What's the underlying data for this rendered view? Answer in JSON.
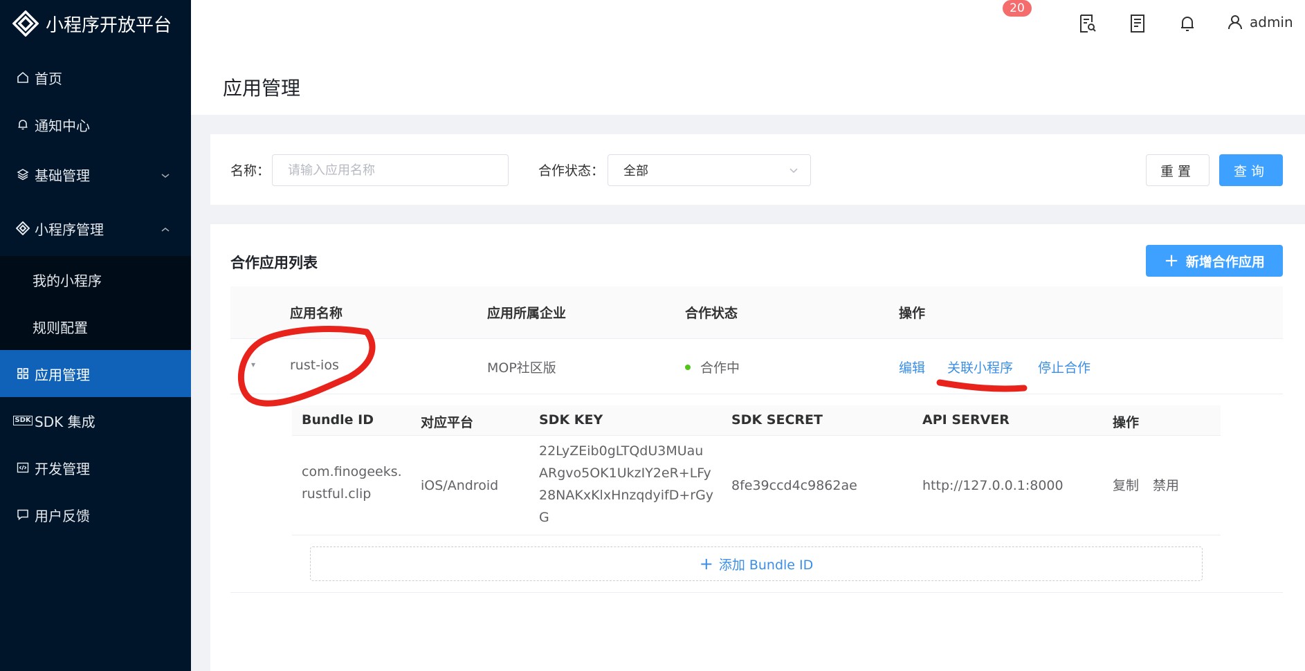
{
  "sidebar": {
    "logo_text": "小程序开放平台",
    "items": [
      {
        "label": "首页",
        "icon": "home-icon"
      },
      {
        "label": "通知中心",
        "icon": "bell-icon"
      },
      {
        "label": "基础管理",
        "icon": "layers-icon"
      },
      {
        "label": "小程序管理",
        "icon": "diamond-logo-icon"
      },
      {
        "label": "我的小程序"
      },
      {
        "label": "规则配置"
      },
      {
        "label": "应用管理",
        "icon": "grid-icon"
      },
      {
        "label": "SDK 集成",
        "icon": "sdk-icon",
        "icon_text": "SDK"
      },
      {
        "label": "开发管理",
        "icon": "code-icon"
      },
      {
        "label": "用户反馈",
        "icon": "message-icon"
      }
    ]
  },
  "header": {
    "notification_count": "20",
    "username": "admin"
  },
  "page": {
    "title": "应用管理"
  },
  "filter": {
    "name_label": "名称：",
    "name_placeholder": "请输入应用名称",
    "status_label": "合作状态：",
    "status_value": "全部",
    "reset_label": "重置",
    "query_label": "查询"
  },
  "list": {
    "title": "合作应用列表",
    "add_button": "新增合作应用",
    "columns": [
      "应用名称",
      "应用所属企业",
      "合作状态",
      "操作"
    ],
    "rows": [
      {
        "name": "rust-ios",
        "company": "MOP社区版",
        "status": "合作中",
        "actions": [
          "编辑",
          "关联小程序",
          "停止合作"
        ]
      }
    ]
  },
  "bundle_table": {
    "columns": [
      "Bundle ID",
      "对应平台",
      "SDK KEY",
      "SDK SECRET",
      "API SERVER",
      "操作"
    ],
    "rows": [
      {
        "bundle_id_line1": "com.finogeeks.",
        "bundle_id_line2": "rustful.clip",
        "platform": "iOS/Android",
        "sdk_key_line1": "22LyZEib0gLTQdU3MUau",
        "sdk_key_line2": "ARgvo5OK1UkzIY2eR+LFy",
        "sdk_key_line3": "28NAKxKlxHnzqdyifD+rGy",
        "sdk_key_line4": "G",
        "sdk_secret": "8fe39ccd4c9862ae",
        "api_server": "http://127.0.0.1:8000",
        "actions": [
          "复制",
          "禁用"
        ]
      }
    ],
    "add_label": "添加 Bundle ID"
  },
  "colors": {
    "sidebar_bg": "#001529",
    "active_menu": "#1062b8",
    "primary": "#3ea1ff",
    "link": "#3a8ee6",
    "danger": "#f5222d",
    "annotation": "#e8231b"
  }
}
